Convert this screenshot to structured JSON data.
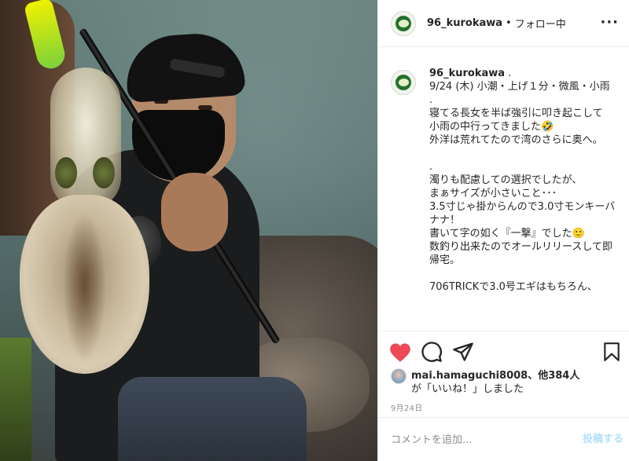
{
  "post": {
    "username": "96_kurokawa",
    "separator": "•",
    "follow_status": "フォロー中",
    "more_icon": "more-horizontal-icon"
  },
  "caption": {
    "username": "96_kurokawa",
    "lines": [
      " .",
      "9/24 (木) 小潮・上げ１分・微風・小雨",
      ".",
      "寝てる長女を半ば強引に叩き起こして",
      "小雨の中行ってきました🤣",
      "外洋は荒れてたので湾のさらに奥へ。",
      "",
      ".",
      "濁りも配慮しての選択でしたが、",
      "まぁサイズが小さいこと･･･",
      "3.5寸じゃ掛からんので3.0寸モンキーバナナ！",
      "書いて字の如く『一撃』でした🙂",
      "数釣り出来たのでオールリリースして即帰宅。",
      "",
      "706TRICKで3.0号エギはもちろん、"
    ]
  },
  "actions": {
    "liked": true,
    "like_color": "#ed4956"
  },
  "likes": {
    "user": "mai.hamaguchi8008",
    "others": "、他384人",
    "line2_prefix": "が",
    "line2_suffix": "「いいね！」しました"
  },
  "date": "9月24日",
  "comment": {
    "placeholder": "コメントを追加...",
    "post_label": "投稿する"
  }
}
